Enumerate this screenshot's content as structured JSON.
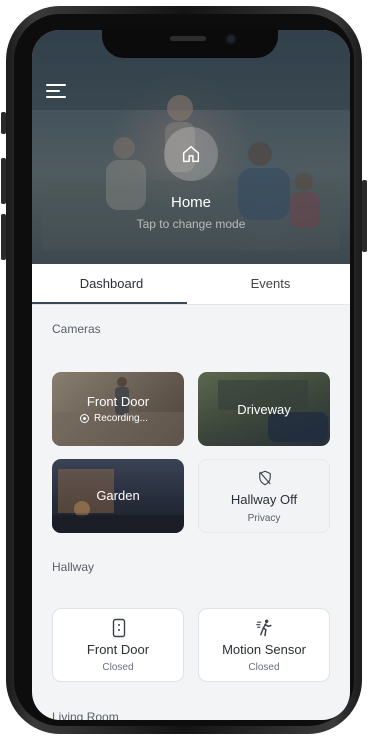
{
  "hero": {
    "title": "Home",
    "subtitle": "Tap to change mode"
  },
  "tabs": [
    {
      "label": "Dashboard",
      "active": true
    },
    {
      "label": "Events",
      "active": false
    }
  ],
  "cameras": {
    "section_title": "Cameras",
    "items": [
      {
        "name": "Front Door",
        "status": "Recording..."
      },
      {
        "name": "Driveway"
      },
      {
        "name": "Garden"
      },
      {
        "name": "Hallway Off",
        "status": "Privacy",
        "icon": "shield-off-icon"
      }
    ]
  },
  "hallway": {
    "section_title": "Hallway",
    "devices": [
      {
        "name": "Front Door",
        "state": "Closed",
        "icon": "door-sensor-icon"
      },
      {
        "name": "Motion Sensor",
        "state": "Closed",
        "icon": "motion-walk-icon"
      }
    ]
  },
  "living_room": {
    "section_title": "Living Room"
  }
}
